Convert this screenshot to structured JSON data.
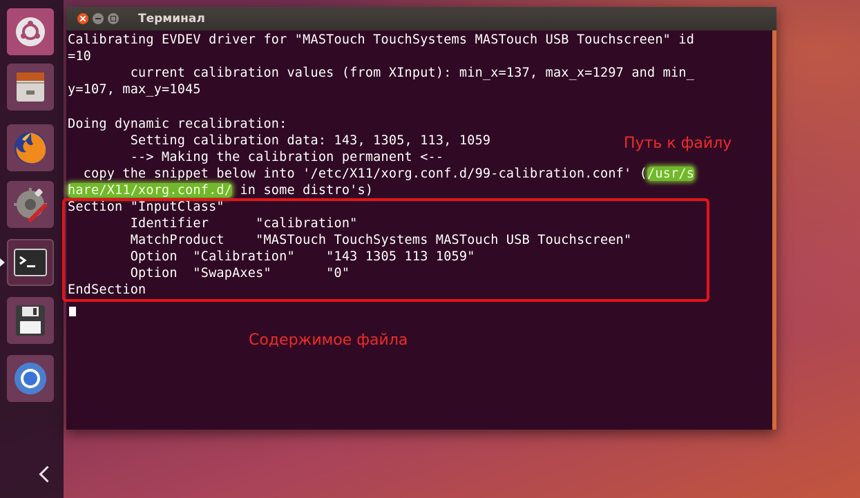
{
  "window": {
    "title": "Терминал"
  },
  "launcher": {
    "items": [
      {
        "icon": "ubuntu-icon"
      },
      {
        "icon": "files-icon"
      },
      {
        "icon": "firefox-icon"
      },
      {
        "icon": "settings-icon"
      },
      {
        "icon": "terminal-icon",
        "active": true
      },
      {
        "icon": "save-icon"
      },
      {
        "icon": "chrome-icon"
      }
    ]
  },
  "terminal": {
    "lines": [
      "Calibrating EVDEV driver for \"MASTouch TouchSystems MASTouch USB Touchscreen\" id",
      "=10",
      "        current calibration values (from XInput): min_x=137, max_x=1297 and min_",
      "y=107, max_y=1045",
      "",
      "Doing dynamic recalibration:",
      "        Setting calibration data: 143, 1305, 113, 1059",
      "        --> Making the calibration permanent <--",
      "  copy the snippet below into '/etc/X11/xorg.conf.d/99-calibration.conf' (",
      "hare/X11/xorg.conf.d/",
      "Section \"InputClass\"",
      "        Identifier      \"calibration\"",
      "        MatchProduct    \"MASTouch TouchSystems MASTouch USB Touchscreen\"",
      "        Option  \"Calibration\"    \"143 1305 113 1059\"",
      "        Option  \"SwapAxes\"       \"0\"",
      "EndSection"
    ],
    "highlight_1": "/usr/s",
    "line_9_rest": " in some distro's)"
  },
  "annotations": {
    "path_label": "Путь к файлу",
    "contents_label": "Содержимое файла"
  },
  "colors": {
    "terminal_bg": "#300a24",
    "annotation_red": "#e3141a",
    "highlight_green": "#72b82b",
    "ubuntu_orange": "#e95420"
  }
}
